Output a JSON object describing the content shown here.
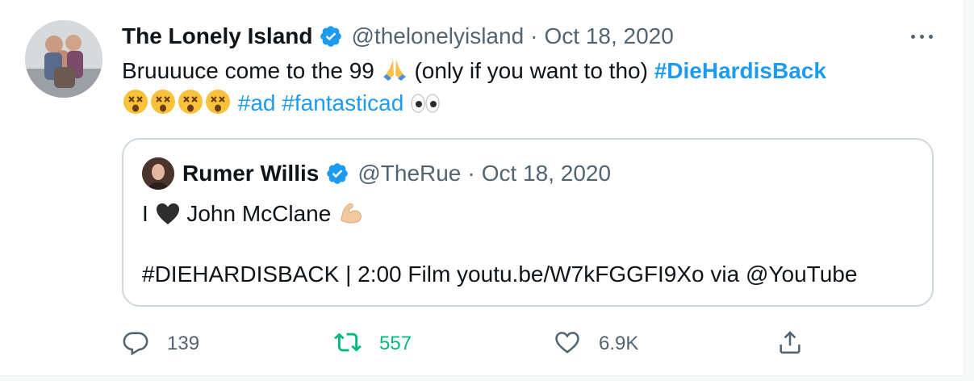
{
  "tweet": {
    "author_name": "The Lonely Island",
    "handle": "@thelonelyisland",
    "separator": "·",
    "date": "Oct 18, 2020",
    "line1_text": "Bruuuuce come to the 99",
    "line1_after": "(only if you want to tho)",
    "hashtag_main": "#DieHardisBack",
    "hashtag_ad": "#ad",
    "hashtag_fantasticad": "#fantasticad"
  },
  "quote": {
    "author_name": "Rumer Willis",
    "handle": "@TheRue",
    "separator": "·",
    "date": "Oct 18, 2020",
    "line1_before": "I",
    "line1_after": "John McClane",
    "line2": "#DIEHARDISBACK | 2:00 Film youtu.be/W7kFGGFI9Xo via @YouTube"
  },
  "actions": {
    "reply_count": "139",
    "retweet_count": "557",
    "like_count": "6.9K"
  },
  "colors": {
    "link": "#1d9bf0",
    "retweet_active": "#00ba7c",
    "muted": "#536471",
    "verified": "#1d9bf0"
  },
  "icons": [
    "verified-badge-icon",
    "more-icon",
    "praying-hands-emoji",
    "dizzy-face-emoji",
    "eyes-emoji",
    "black-heart-emoji",
    "flexed-biceps-emoji",
    "reply-icon",
    "retweet-icon",
    "like-icon",
    "share-icon"
  ]
}
